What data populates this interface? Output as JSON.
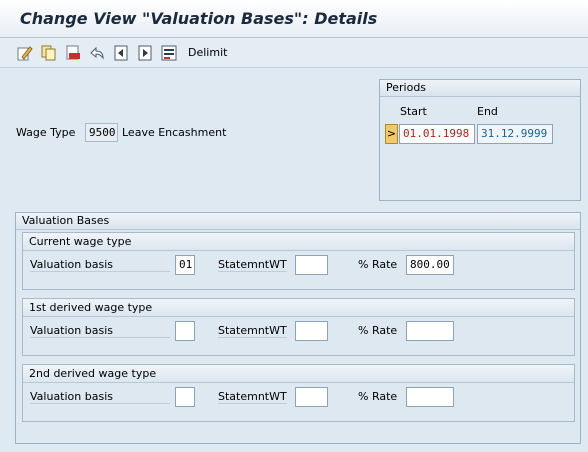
{
  "title": "Change View \"Valuation Bases\": Details",
  "toolbar": {
    "icons": [
      "edit-icon",
      "copy-icon",
      "delete-icon",
      "undo-icon",
      "previous-entry-icon",
      "next-entry-icon",
      "select-icon"
    ],
    "delimit_label": "Delimit"
  },
  "wage_type": {
    "label": "Wage Type",
    "code": "9500",
    "description": "Leave Encashment"
  },
  "periods": {
    "title": "Periods",
    "start_label": "Start",
    "end_label": "End",
    "start_value": "01.01.1998",
    "end_value": "31.12.9999",
    "marker": ">"
  },
  "valuation_bases": {
    "title": "Valuation Bases",
    "groups": [
      {
        "title": "Current wage type",
        "valuation_basis_label": "Valuation basis",
        "valuation_basis_value": "01",
        "statement_label": "StatemntWT",
        "statement_value": "",
        "rate_label": "% Rate",
        "rate_value": "800.00"
      },
      {
        "title": "1st derived wage type",
        "valuation_basis_label": "Valuation basis",
        "valuation_basis_value": "",
        "statement_label": "StatemntWT",
        "statement_value": "",
        "rate_label": "% Rate",
        "rate_value": ""
      },
      {
        "title": "2nd derived wage type",
        "valuation_basis_label": "Valuation basis",
        "valuation_basis_value": "",
        "statement_label": "StatemntWT",
        "statement_value": "",
        "rate_label": "% Rate",
        "rate_value": ""
      }
    ]
  },
  "colors": {
    "start_date": "#b02020",
    "end_date": "#1a5e9a",
    "marker_bg": "#f2c96a"
  }
}
